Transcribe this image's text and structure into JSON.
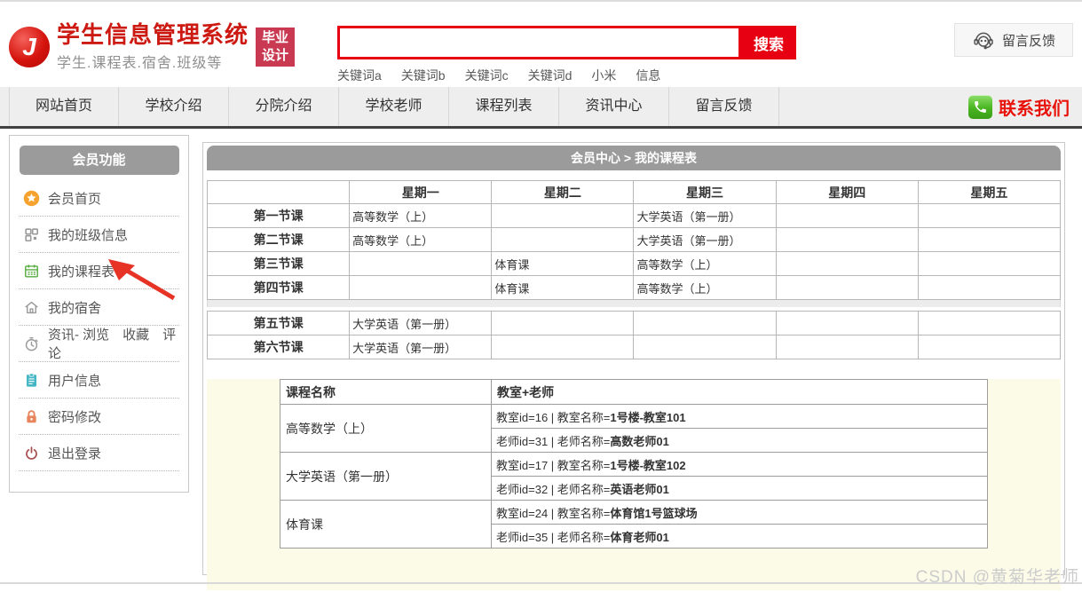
{
  "header": {
    "logo": {
      "letter": "J",
      "title": "学生信息管理系统",
      "subtitle": "学生.课程表.宿舍.班级等",
      "badge_lines": [
        "毕业",
        "设计"
      ]
    },
    "search": {
      "value": "",
      "placeholder": "",
      "button": "搜索",
      "keywords": [
        "关键词a",
        "关键词b",
        "关键词c",
        "关键词d",
        "小米",
        "信息"
      ]
    },
    "feedback_button": "留言反馈"
  },
  "nav": {
    "items": [
      "网站首页",
      "学校介绍",
      "分院介绍",
      "学校老师",
      "课程列表",
      "资讯中心",
      "留言反馈"
    ],
    "contact": "联系我们"
  },
  "sidebar": {
    "title": "会员功能",
    "items": [
      {
        "label": "会员首页",
        "icon": "member-home-icon"
      },
      {
        "label": "我的班级信息",
        "icon": "class-info-icon"
      },
      {
        "label": "我的课程表",
        "icon": "course-table-icon"
      },
      {
        "label": "我的宿舍",
        "icon": "dorm-icon"
      },
      {
        "label": "资讯- 浏览　收藏　评论",
        "icon": "news-clock-icon"
      },
      {
        "label": "用户信息",
        "icon": "user-info-icon"
      },
      {
        "label": "密码修改",
        "icon": "password-lock-icon"
      },
      {
        "label": "退出登录",
        "icon": "logout-power-icon"
      }
    ]
  },
  "main": {
    "breadcrumb": "会员中心 > 我的课程表",
    "schedule": {
      "columns": [
        "",
        "星期一",
        "星期二",
        "星期三",
        "星期四",
        "星期五"
      ],
      "rows_morning": [
        {
          "label": "第一节课",
          "cells": [
            "高等数学（上）",
            "",
            "大学英语（第一册）",
            "",
            ""
          ]
        },
        {
          "label": "第二节课",
          "cells": [
            "高等数学（上）",
            "",
            "大学英语（第一册）",
            "",
            ""
          ]
        },
        {
          "label": "第三节课",
          "cells": [
            "",
            "体育课",
            "高等数学（上）",
            "",
            ""
          ]
        },
        {
          "label": "第四节课",
          "cells": [
            "",
            "体育课",
            "高等数学（上）",
            "",
            ""
          ]
        }
      ],
      "rows_afternoon": [
        {
          "label": "第五节课",
          "cells": [
            "大学英语（第一册）",
            "",
            "",
            "",
            ""
          ]
        },
        {
          "label": "第六节课",
          "cells": [
            "大学英语（第一册）",
            "",
            "",
            "",
            ""
          ]
        }
      ]
    },
    "details": {
      "headers": [
        "课程名称",
        "教室+老师"
      ],
      "courses": [
        {
          "name": "高等数学（上）",
          "lines": [
            {
              "prefix": "教室id=16 | 教室名称=",
              "value": "1号楼-教室101"
            },
            {
              "prefix": "老师id=31 | 老师名称=",
              "value": "高数老师01"
            }
          ]
        },
        {
          "name": "大学英语（第一册）",
          "lines": [
            {
              "prefix": "教室id=17 | 教室名称=",
              "value": "1号楼-教室102"
            },
            {
              "prefix": "老师id=32 | 老师名称=",
              "value": "英语老师01"
            }
          ]
        },
        {
          "name": "体育课",
          "lines": [
            {
              "prefix": "教室id=24 | 教室名称=",
              "value": "体育馆1号篮球场"
            },
            {
              "prefix": "老师id=35 | 老师名称=",
              "value": "体育老师01"
            }
          ]
        }
      ]
    }
  },
  "watermark": "CSDN @黄菊华老师",
  "colors": {
    "brand_red": "#cc1a12",
    "search_red": "#e60012",
    "badge_bg": "#c93a52",
    "bar_gray": "#9b9b9b",
    "nav_bg": "#eeeeee",
    "nav_border": "#414141",
    "beige_bg": "#fbfbe8",
    "contact_green": "#49b521",
    "contact_red": "#e8140c",
    "annotation_red": "#e63326"
  }
}
